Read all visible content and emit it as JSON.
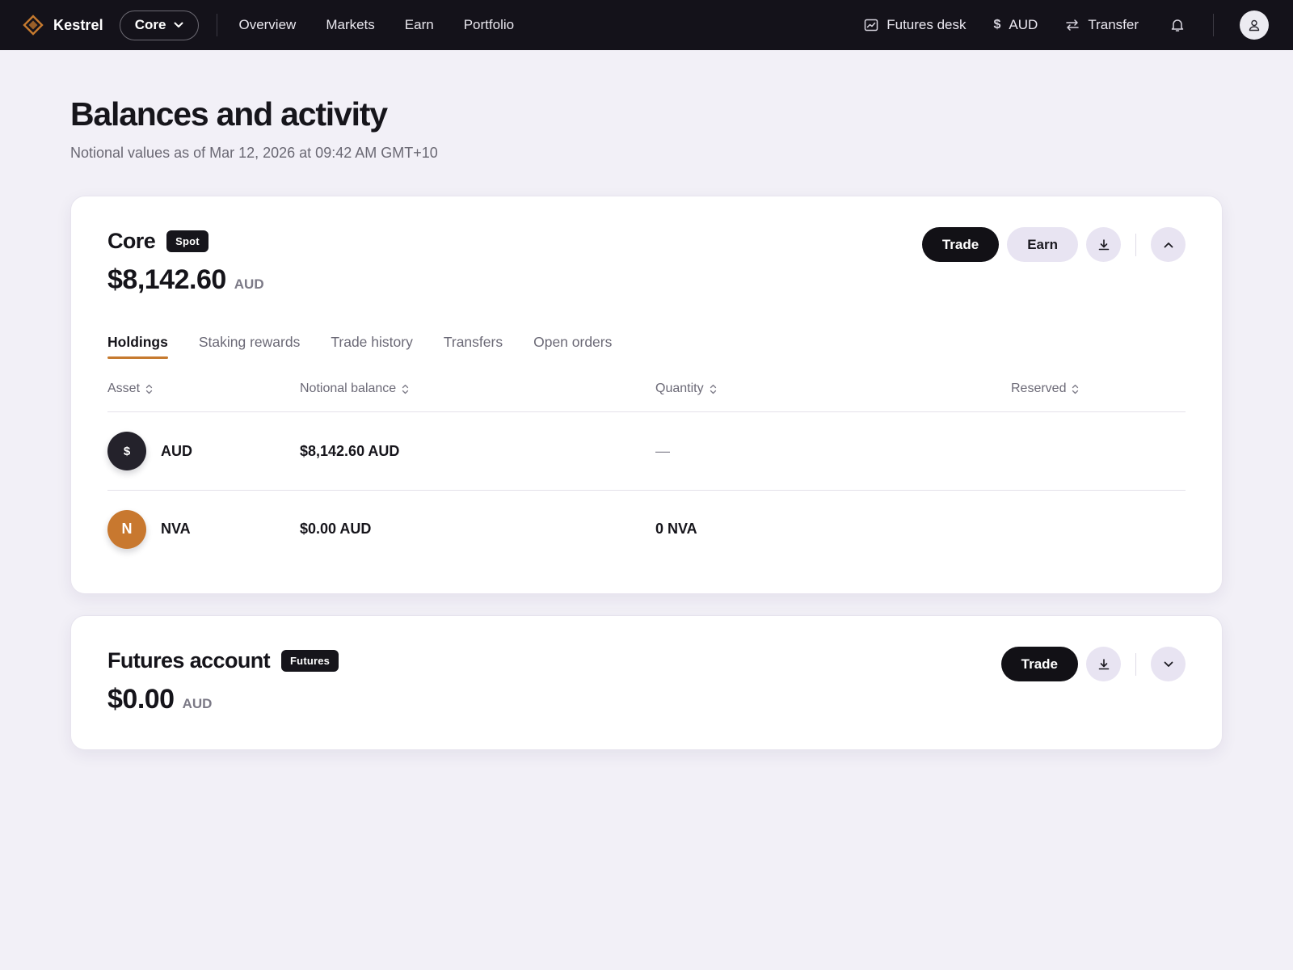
{
  "colors": {
    "nav_bg": "#14121a",
    "page_bg": "#f2f0f7",
    "accent": "#c67a2f",
    "dark_button": "#121116",
    "soft_button": "#e8e4f2",
    "aud_icon_bg": "#24222b",
    "nva_icon_bg": "#c8782f"
  },
  "nav": {
    "brand": "Kestrel",
    "brand_icon": "kestrel-diamond-logo",
    "account_switch": "Core",
    "links": [
      "Overview",
      "Markets",
      "Earn",
      "Portfolio"
    ],
    "futures_desk": "Futures desk",
    "currency": "AUD",
    "transfer": "Transfer",
    "icons": [
      "chart-icon",
      "dollar-icon",
      "transfer-arrows-icon",
      "bell-icon",
      "user-icon"
    ]
  },
  "page": {
    "title": "Balances and activity",
    "subtitle": "Notional values as of Mar 12, 2026 at 09:42 AM GMT+10"
  },
  "core": {
    "name": "Core",
    "badge": "Spot",
    "amount": "$8,142.60",
    "currency": "AUD",
    "actions": {
      "trade": "Trade",
      "earn": "Earn"
    },
    "tabs": [
      "Holdings",
      "Staking rewards",
      "Trade history",
      "Transfers",
      "Open orders"
    ],
    "active_tab": "Holdings",
    "columns": [
      "Asset",
      "Notional balance",
      "Quantity",
      "Reserved"
    ],
    "rows": [
      {
        "icon_glyph": "$",
        "asset": "AUD",
        "notional": "$8,142.60 AUD",
        "quantity": "—",
        "reserved": ""
      },
      {
        "icon_glyph": "N",
        "asset": "NVA",
        "notional": "$0.00 AUD",
        "quantity": "0 NVA",
        "reserved": ""
      }
    ]
  },
  "futures": {
    "name": "Futures account",
    "badge": "Futures",
    "amount": "$0.00",
    "currency": "AUD",
    "actions": {
      "trade": "Trade"
    }
  }
}
